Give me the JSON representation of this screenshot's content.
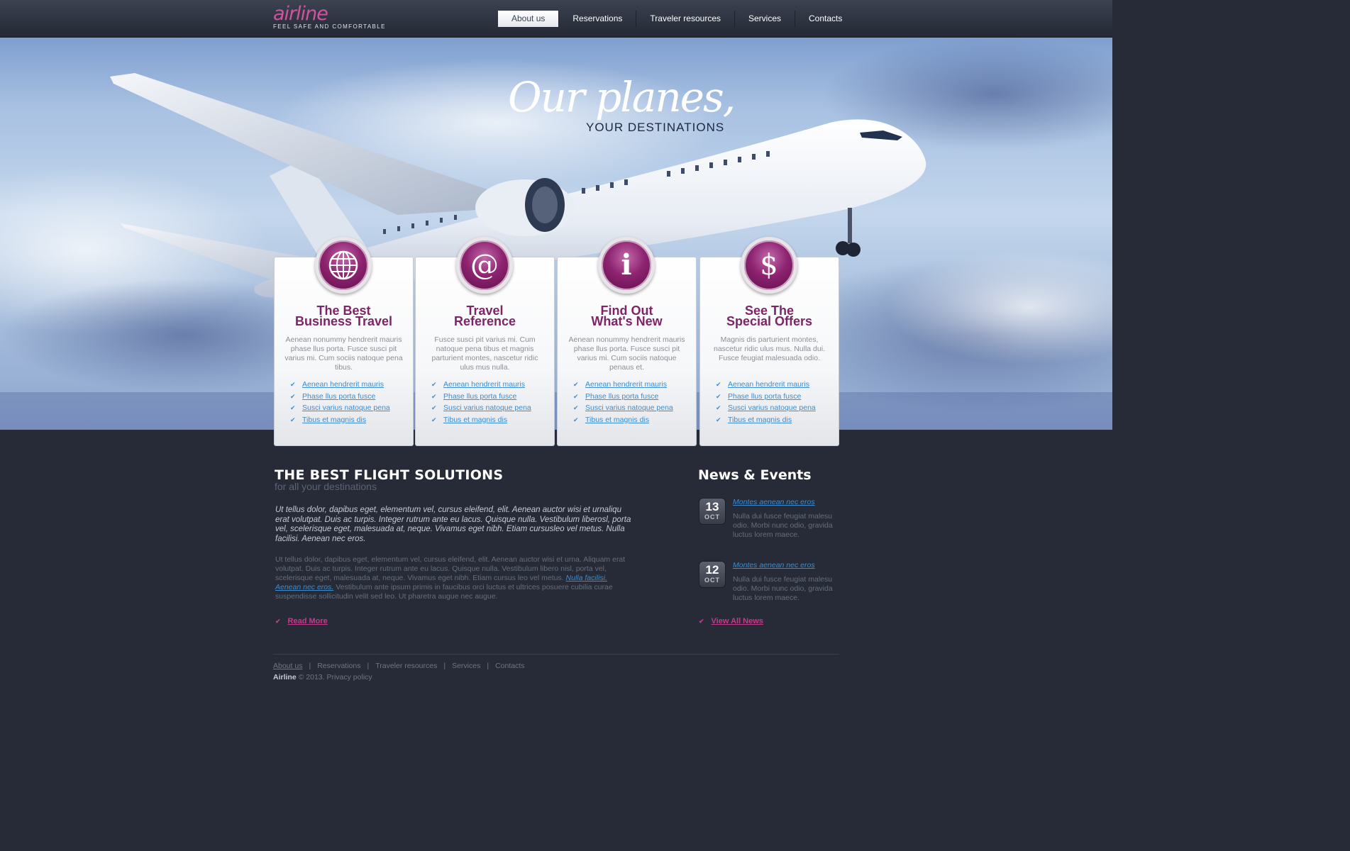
{
  "brand": {
    "logo": "airline",
    "tagline": "FEEL SAFE AND COMFORTABLE"
  },
  "nav": [
    "About us",
    "Reservations",
    "Traveler resources",
    "Services",
    "Contacts"
  ],
  "hero": {
    "title": "Our planes,",
    "subtitle": "YOUR DESTINATIONS"
  },
  "features": [
    {
      "icon": "globe-icon",
      "title1": "The Best",
      "title2": "Business Travel",
      "text": "Aenean nonummy hendrerit mauris phase llus porta. Fusce susci pit varius mi. Cum sociis natoque pena tibus.",
      "links": [
        "Aenean hendrerit mauris",
        "Phase llus porta fusce",
        "Susci varius natoque pena",
        "Tibus et magnis dis"
      ]
    },
    {
      "icon": "at-sign-icon",
      "title1": "Travel",
      "title2": "Reference",
      "text": "Fusce susci pit varius mi. Cum natoque pena tibus et magnis parturient montes, nascetur ridic ulus mus nulla.",
      "links": [
        "Aenean hendrerit mauris",
        "Phase llus porta fusce",
        "Susci varius natoque pena",
        "Tibus et magnis dis"
      ]
    },
    {
      "icon": "info-icon",
      "title1": "Find Out",
      "title2": "What's New",
      "text": "Aenean nonummy hendrerit mauris phase llus porta. Fusce susci pit varius mi. Cum sociis natoque penaus et.",
      "links": [
        "Aenean hendrerit mauris",
        "Phase llus porta fusce",
        "Susci varius natoque pena",
        "Tibus et magnis dis"
      ]
    },
    {
      "icon": "dollar-icon",
      "title1": "See The",
      "title2": "Special Offers",
      "text": "Magnis dis parturient montes, nascetur ridic ulus mus. Nulla dui. Fusce feugiat malesuada odio.",
      "links": [
        "Aenean hendrerit mauris",
        "Phase llus porta fusce",
        "Susci varius natoque pena",
        "Tibus et magnis dis"
      ]
    }
  ],
  "main": {
    "title": "THE BEST FLIGHT SOLUTIONS",
    "subtitle": "for all your destinations",
    "lead": "Ut tellus dolor, dapibus eget, elementum vel, cursus eleifend, elit. Aenean auctor wisi et urnaliqu erat volutpat. Duis ac turpis. Integer rutrum ante eu lacus. Quisque nulla. Vestibulum liberosl, porta vel, scelerisque eget, malesuada at, neque. Vivamus eget nibh. Etiam cursusleo vel metus. Nulla facilisi. Aenean nec eros.",
    "body_start": "Ut tellus dolor, dapibus eget, elementum vel, cursus eleifend, elit. Aenean auctor wisi et urna. Aliquam erat volutpat. Duis ac turpis. Integer rutrum ante eu lacus. Quisque nulla. Vestibulum libero nisl, porta vel, scelerisque eget, malesuada at, neque. Vivamus eget nibh. Etiam cursus leo vel metus.",
    "body_link": "Nulla facilisi. Aenean nec eros.",
    "body_end": "Vestibulum ante ipsum primis in faucibus orci luctus et ultrices posuere cubilia curae suspendisse sollicitudin velit sed leo. Ut pharetra augue nec augue.",
    "read_more": "Read More"
  },
  "news": {
    "title": "News & Events",
    "items": [
      {
        "day": "13",
        "month": "OCT",
        "link": "Montes aenean nec eros",
        "text": "Nulla dui fusce feugiat malesu odio. Morbi nunc odio, gravida luctus lorem maece."
      },
      {
        "day": "12",
        "month": "OCT",
        "link": "Montes aenean nec eros",
        "text": "Nulla dui fusce feugiat malesu odio. Morbi nunc odio, gravida luctus lorem maece."
      }
    ],
    "view_all": "View All News"
  },
  "footer": {
    "links": [
      "About us",
      "Reservations",
      "Traveler resources",
      "Services",
      "Contacts"
    ],
    "brand": "Airline",
    "copy": "© 2013.",
    "privacy": "Privacy policy"
  },
  "colors": {
    "accent": "#c53a8c",
    "feature_title": "#7d2468",
    "link": "#3d8ccf",
    "background": "#262b37"
  }
}
